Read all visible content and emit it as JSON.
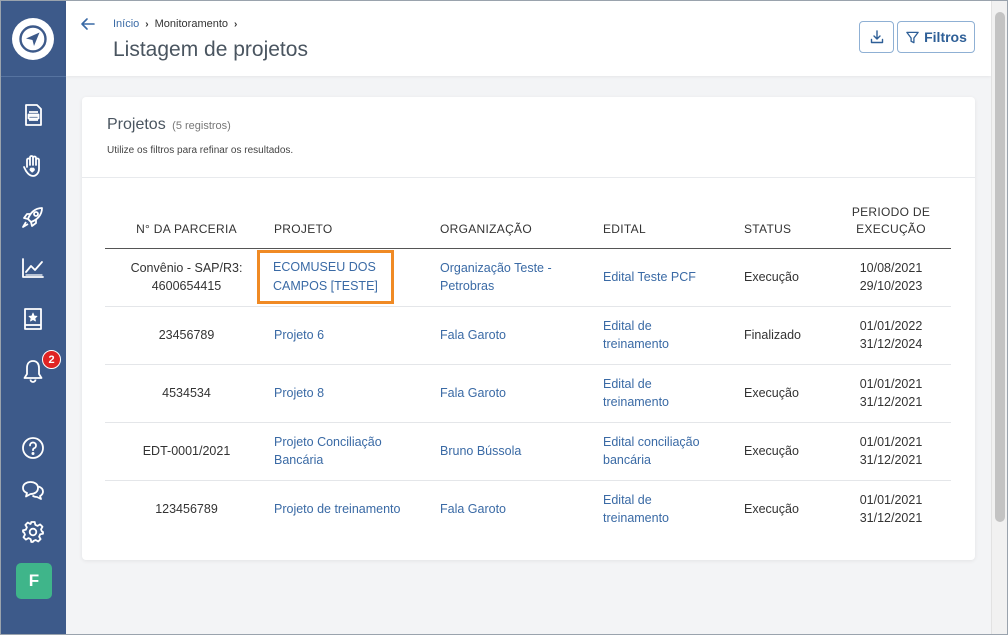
{
  "header": {
    "breadcrumb": {
      "home": "Início",
      "current": "Monitoramento"
    },
    "title": "Listagem de projetos",
    "filter_label": "Filtros"
  },
  "sidebar": {
    "notification_count": "2",
    "avatar_initial": "F"
  },
  "card": {
    "title": "Projetos",
    "count": "(5 registros)",
    "subtitle": "Utilize os filtros para refinar os resultados."
  },
  "table": {
    "headers": {
      "parceria": "N° DA PARCERIA",
      "projeto": "PROJETO",
      "organizacao": "ORGANIZAÇÃO",
      "edital": "EDITAL",
      "status": "STATUS",
      "periodo_1": "PERIODO DE",
      "periodo_2": "EXECUÇÃO"
    },
    "rows": [
      {
        "parceria_1": "Convênio - SAP/R3:",
        "parceria_2": "4600654415",
        "projeto_1": "ECOMUSEU DOS",
        "projeto_2": "CAMPOS [TESTE]",
        "organizacao_1": "Organização Teste -",
        "organizacao_2": "Petrobras",
        "edital_1": "Edital Teste PCF",
        "edital_2": "",
        "status": "Execução",
        "inicio": "10/08/2021",
        "fim": "29/10/2023"
      },
      {
        "parceria_1": "23456789",
        "parceria_2": "",
        "projeto_1": "Projeto 6",
        "projeto_2": "",
        "organizacao_1": "Fala Garoto",
        "organizacao_2": "",
        "edital_1": "Edital de",
        "edital_2": "treinamento",
        "status": "Finalizado",
        "inicio": "01/01/2022",
        "fim": "31/12/2024"
      },
      {
        "parceria_1": "4534534",
        "parceria_2": "",
        "projeto_1": "Projeto 8",
        "projeto_2": "",
        "organizacao_1": "Fala Garoto",
        "organizacao_2": "",
        "edital_1": "Edital de",
        "edital_2": "treinamento",
        "status": "Execução",
        "inicio": "01/01/2021",
        "fim": "31/12/2021"
      },
      {
        "parceria_1": "EDT-0001/2021",
        "parceria_2": "",
        "projeto_1": "Projeto Conciliação",
        "projeto_2": "Bancária",
        "organizacao_1": "Bruno Bússola",
        "organizacao_2": "",
        "edital_1": "Edital conciliação",
        "edital_2": "bancária",
        "status": "Execução",
        "inicio": "01/01/2021",
        "fim": "31/12/2021"
      },
      {
        "parceria_1": "123456789",
        "parceria_2": "",
        "projeto_1": "Projeto de treinamento",
        "projeto_2": "",
        "organizacao_1": "Fala Garoto",
        "organizacao_2": "",
        "edital_1": "Edital de",
        "edital_2": "treinamento",
        "status": "Execução",
        "inicio": "01/01/2021",
        "fim": "31/12/2021"
      }
    ]
  },
  "colors": {
    "sidebar": "#3d5a8a",
    "link": "#3a6aa5",
    "highlight": "#f08a24",
    "badge": "#e02424",
    "avatar": "#3fb58a"
  },
  "icons": {
    "logo": "compass-arrow-icon",
    "nav": [
      "document-icon",
      "hand-heart-icon",
      "rocket-icon",
      "chart-line-icon",
      "book-star-icon",
      "bell-icon",
      "help-icon",
      "chat-icon",
      "gear-icon"
    ]
  }
}
